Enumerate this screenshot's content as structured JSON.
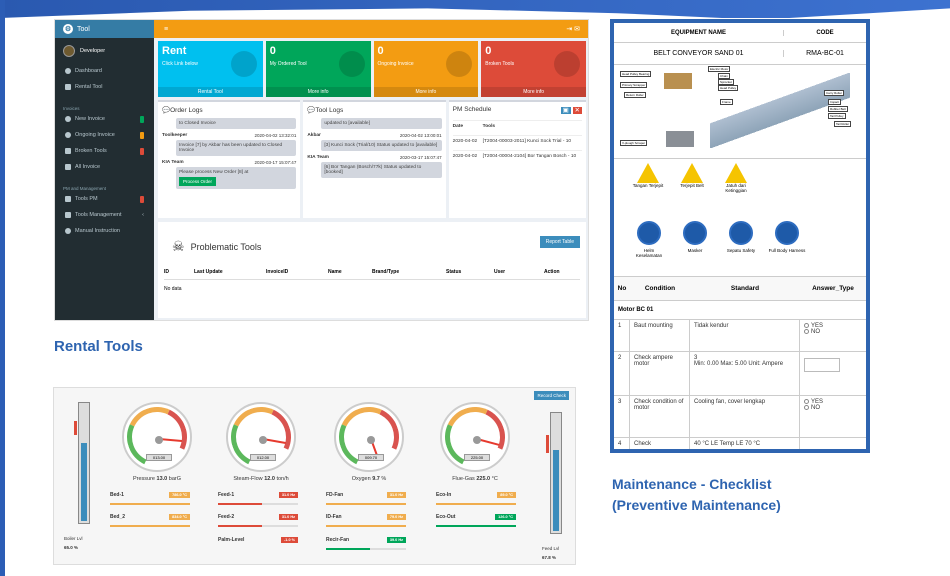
{
  "rental": {
    "brand": "Tool",
    "user": "Developer",
    "menu": [
      "Dashboard",
      "Rental Tool"
    ],
    "sec_invoice": "Invoices",
    "invoice_items": [
      "New Invoice",
      "Ongoing Invoice",
      "Broken Tools",
      "All Invoice"
    ],
    "sec_pm": "PM and Management",
    "pm_items": [
      "Tools PM",
      "Tools Management",
      "Manual Instruction"
    ],
    "boxes": [
      {
        "num": "Rent",
        "label": "Click Link below",
        "foot": "Rental Tool",
        "color": "#00c0ef"
      },
      {
        "num": "0",
        "label": "My Ordered Tool",
        "foot": "More info",
        "color": "#00a65a"
      },
      {
        "num": "0",
        "label": "Ongoing Invoice",
        "foot": "More info",
        "color": "#f39c12"
      },
      {
        "num": "0",
        "label": "Broken Tools",
        "foot": "More info",
        "color": "#dd4b39"
      }
    ],
    "order_logs": {
      "title": "Order Logs",
      "top": "to Closed Invoice",
      "e1_user": "Toolkeeper",
      "e1_time": "2020-04-02 13:32:01",
      "e1_msg": "Invoice [7] by Akbar has been updated to Closed Invoice",
      "e2_user": "KIA Team",
      "e2_time": "2020-03-17 15:07:47",
      "e2_msg": "Please process New Order [8] at",
      "e2_btn": "Process Order"
    },
    "tool_logs": {
      "title": "Tool Logs",
      "top": "updated to [available]",
      "e1_user": "Akbar",
      "e1_time": "2020-04-02 13:00:01",
      "e1_msg": "[3] Kunci Sock (Trial/10) Status updated to [available]",
      "e2_user": "KIA Team",
      "e2_time": "2020-03-17 15:07:47",
      "e2_msg": "[6] Bor Tangan (Bosch/77k) Status updated to [booked]"
    },
    "pm": {
      "title": "PM Schedule",
      "col_date": "Date",
      "col_tools": "Tools",
      "r1_date": "2020-04-02",
      "r1_tools": "[T2004-00003-2011] Kunci Sock Trial - 10",
      "r2_date": "2020-04-02",
      "r2_tools": "[T2004-00004-2104] Bor Tangan Bosch - 10"
    },
    "problem": {
      "title": "Problematic Tools",
      "btn": "Report Table",
      "cols": [
        "ID",
        "Last Update",
        "InvoiceID",
        "Name",
        "Brand/Type",
        "Status",
        "User",
        "Action"
      ],
      "empty": "No data"
    }
  },
  "caption_rental": "Rental Tools",
  "gauges": {
    "record": "Record Check",
    "left_label": "Boiler Lvl",
    "left_val": "65.0 %",
    "right_label": "Feed Lvl",
    "right_val": "67.8 %",
    "left_level": 0.65,
    "right_level": 0.678,
    "dials": [
      {
        "name": "Pressure",
        "value": "13.0",
        "unit": "barG",
        "disp": "013.00"
      },
      {
        "name": "Steam-Flow",
        "value": "12.0",
        "unit": "ton/h",
        "disp": "012.00"
      },
      {
        "name": "Oxygen",
        "value": "9.7",
        "unit": "%",
        "disp": "009.70"
      },
      {
        "name": "Flue-Gas",
        "value": "225.0",
        "unit": "°C",
        "disp": "225.00"
      }
    ],
    "metrics": [
      {
        "name": "Bed-1",
        "val": "786.0 °C",
        "color": "#f0ad4e"
      },
      {
        "name": "Bed_2",
        "val": "834.0 °C",
        "color": "#f0ad4e"
      },
      {
        "name": "Feed-1",
        "val": "31.0 Hz",
        "color": "#dd4b39"
      },
      {
        "name": "Feed-2",
        "val": "31.0 Hz",
        "color": "#dd4b39"
      },
      {
        "name": "Palm-Level",
        "val": "-1.0 %",
        "color": "#dd4b39"
      },
      {
        "name": "FD-Fan",
        "val": "31.0 Hz",
        "color": "#f0ad4e"
      },
      {
        "name": "ID-Fan",
        "val": "79.0 Hz",
        "color": "#f0ad4e"
      },
      {
        "name": "Recir-Fan",
        "val": "39.0 Hz",
        "color": "#00a65a"
      },
      {
        "name": "Eco-In",
        "val": "89.0 °C",
        "color": "#f0ad4e"
      },
      {
        "name": "Eco-Out",
        "val": "126.0 °C",
        "color": "#00a65a"
      }
    ]
  },
  "checklist": {
    "h_name": "EQUIPMENT NAME",
    "h_code": "CODE",
    "name": "BELT CONVEYOR SAND 01",
    "code": "RMA-BC-01",
    "warnings": [
      "Tangan Terjepit",
      "Terjepit Belt",
      "Jatuh dari Ketinggian"
    ],
    "mandatory": [
      "Helm Keselamatan",
      "Masker",
      "Sepatu Safety",
      "Full Body Harness"
    ],
    "diagram_labels": [
      "Head Pulley Bearing",
      "Primary Scrapper",
      "Return Roller",
      "V-plough Scraper",
      "Electric Motor",
      "Chain",
      "Sprocket",
      "Head Pulley",
      "Frame",
      "Carry Roller",
      "Impact",
      "Rubber Belt",
      "Tail Pulley",
      "Tail Roller"
    ],
    "cols": [
      "No",
      "Condition",
      "Standard",
      "Answer_Type"
    ],
    "section": "Motor BC 01",
    "rows": [
      {
        "no": "1",
        "cond": "Baut mounting",
        "std": "Tidak kendur",
        "type": "radio",
        "opt1": "YES",
        "opt2": "NO"
      },
      {
        "no": "2",
        "cond": "Check ampere motor",
        "std_l1": "3",
        "std_l2": "Min: 0.00 Max: 5.00 Unit: Ampere",
        "type": "input"
      },
      {
        "no": "3",
        "cond": "Check condition of motor",
        "std": "Cooling fan, cover lengkap",
        "type": "radio",
        "opt1": "YES",
        "opt2": "NO"
      },
      {
        "no": "4",
        "cond": "Check",
        "std": "40 °C LE Temp LE 70 °C",
        "type": "input"
      }
    ]
  },
  "caption_check_1": "Maintenance - Checklist",
  "caption_check_2": "(Preventive Maintenance)"
}
